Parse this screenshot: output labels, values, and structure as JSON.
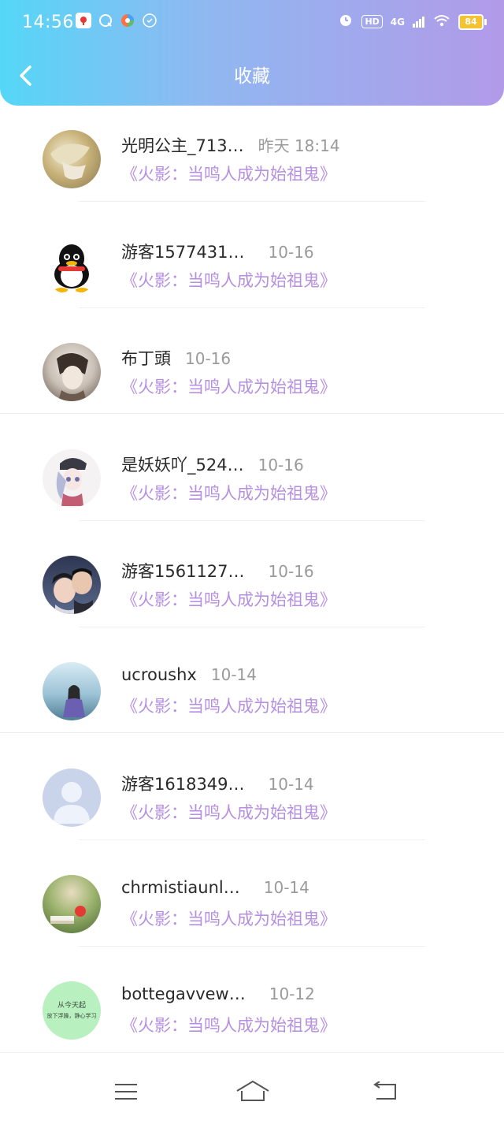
{
  "status_bar": {
    "time": "14:56",
    "network": "4G",
    "hd": "HD",
    "battery": "84"
  },
  "header": {
    "title": "收藏",
    "back_icon": "chevron-left-icon"
  },
  "items": [
    {
      "name": "光明公主_713…",
      "time": "昨天 18:14",
      "link": "《火影：当鸣人成为始祖鬼》",
      "avatar_color": "#c9b37a"
    },
    {
      "name": "游客1577431…",
      "time": "10-16",
      "link": "《火影：当鸣人成为始祖鬼》",
      "avatar_color": "#ffffff"
    },
    {
      "name": "布丁頭",
      "time": "10-16",
      "link": "《火影：当鸣人成为始祖鬼》",
      "avatar_color": "#8a7a6a"
    },
    {
      "name": "是妖妖吖_524…",
      "time": "10-16",
      "link": "《火影：当鸣人成为始祖鬼》",
      "avatar_color": "#d9d2da"
    },
    {
      "name": "游客1561127…",
      "time": "10-16",
      "link": "《火影：当鸣人成为始祖鬼》",
      "avatar_color": "#3a4560"
    },
    {
      "name": "ucroushx",
      "time": "10-14",
      "link": "《火影：当鸣人成为始祖鬼》",
      "avatar_color": "#8fb6c9"
    },
    {
      "name": "游客1618349…",
      "time": "10-14",
      "link": "《火影：当鸣人成为始祖鬼》",
      "avatar_color": "#c9d3ea"
    },
    {
      "name": "chrmistiaunl…",
      "time": "10-14",
      "link": "《火影：当鸣人成为始祖鬼》",
      "avatar_color": "#6a8a52"
    },
    {
      "name": "bottegavvew…",
      "time": "10-12",
      "link": "《火影：当鸣人成为始祖鬼》",
      "avatar_color": "#b9f0c0",
      "avatar_text_1": "从今天起",
      "avatar_text_2": "放下浮躁，静心学习"
    }
  ],
  "nav": {
    "menu_icon": "menu-icon",
    "home_icon": "home-icon",
    "back_icon": "back-icon"
  }
}
